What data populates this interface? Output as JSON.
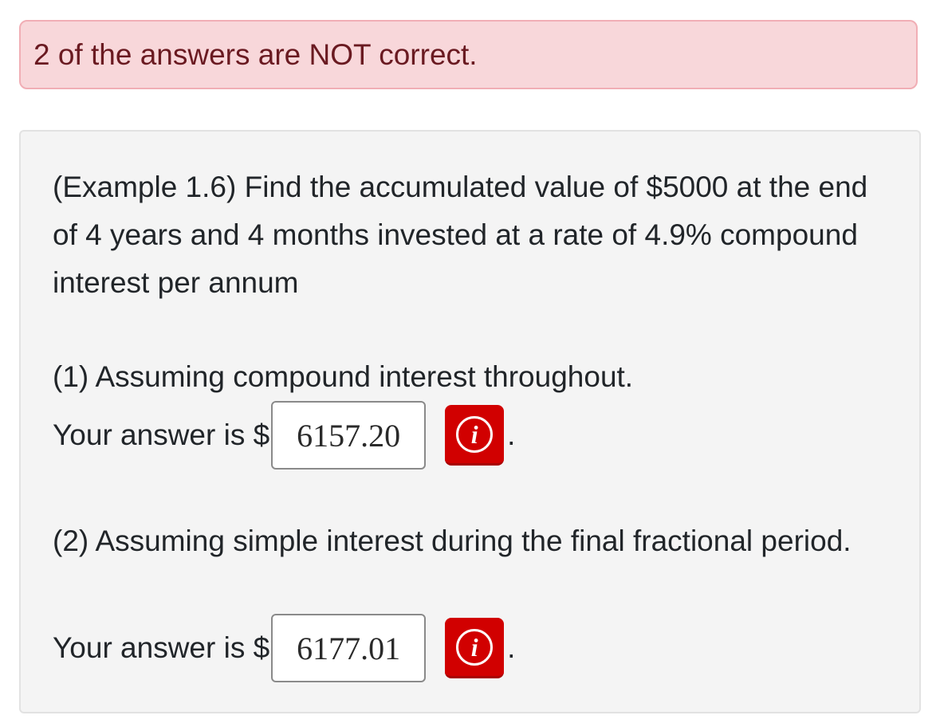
{
  "alert": {
    "message": "2 of the answers are NOT correct."
  },
  "problem": {
    "statement": "(Example 1.6) Find the accumulated value of $5000 at the end of 4 years and 4 months invested at a rate of 4.9% compound interest per annum"
  },
  "parts": [
    {
      "question": "(1) Assuming compound interest throughout.",
      "answer_prefix": "Your answer is $",
      "answer_value": "6157.20",
      "feedback_icon": "info-icon",
      "suffix": "."
    },
    {
      "question": "(2) Assuming simple interest during the final fractional period.",
      "answer_prefix": "Your answer is $",
      "answer_value": "6177.01",
      "feedback_icon": "info-icon",
      "suffix": "."
    }
  ],
  "colors": {
    "alert_background": "#f8d7da",
    "alert_border": "#f1aeb5",
    "alert_text": "#6a1a21",
    "feedback_button": "#d10000",
    "card_background": "#f4f4f4"
  }
}
